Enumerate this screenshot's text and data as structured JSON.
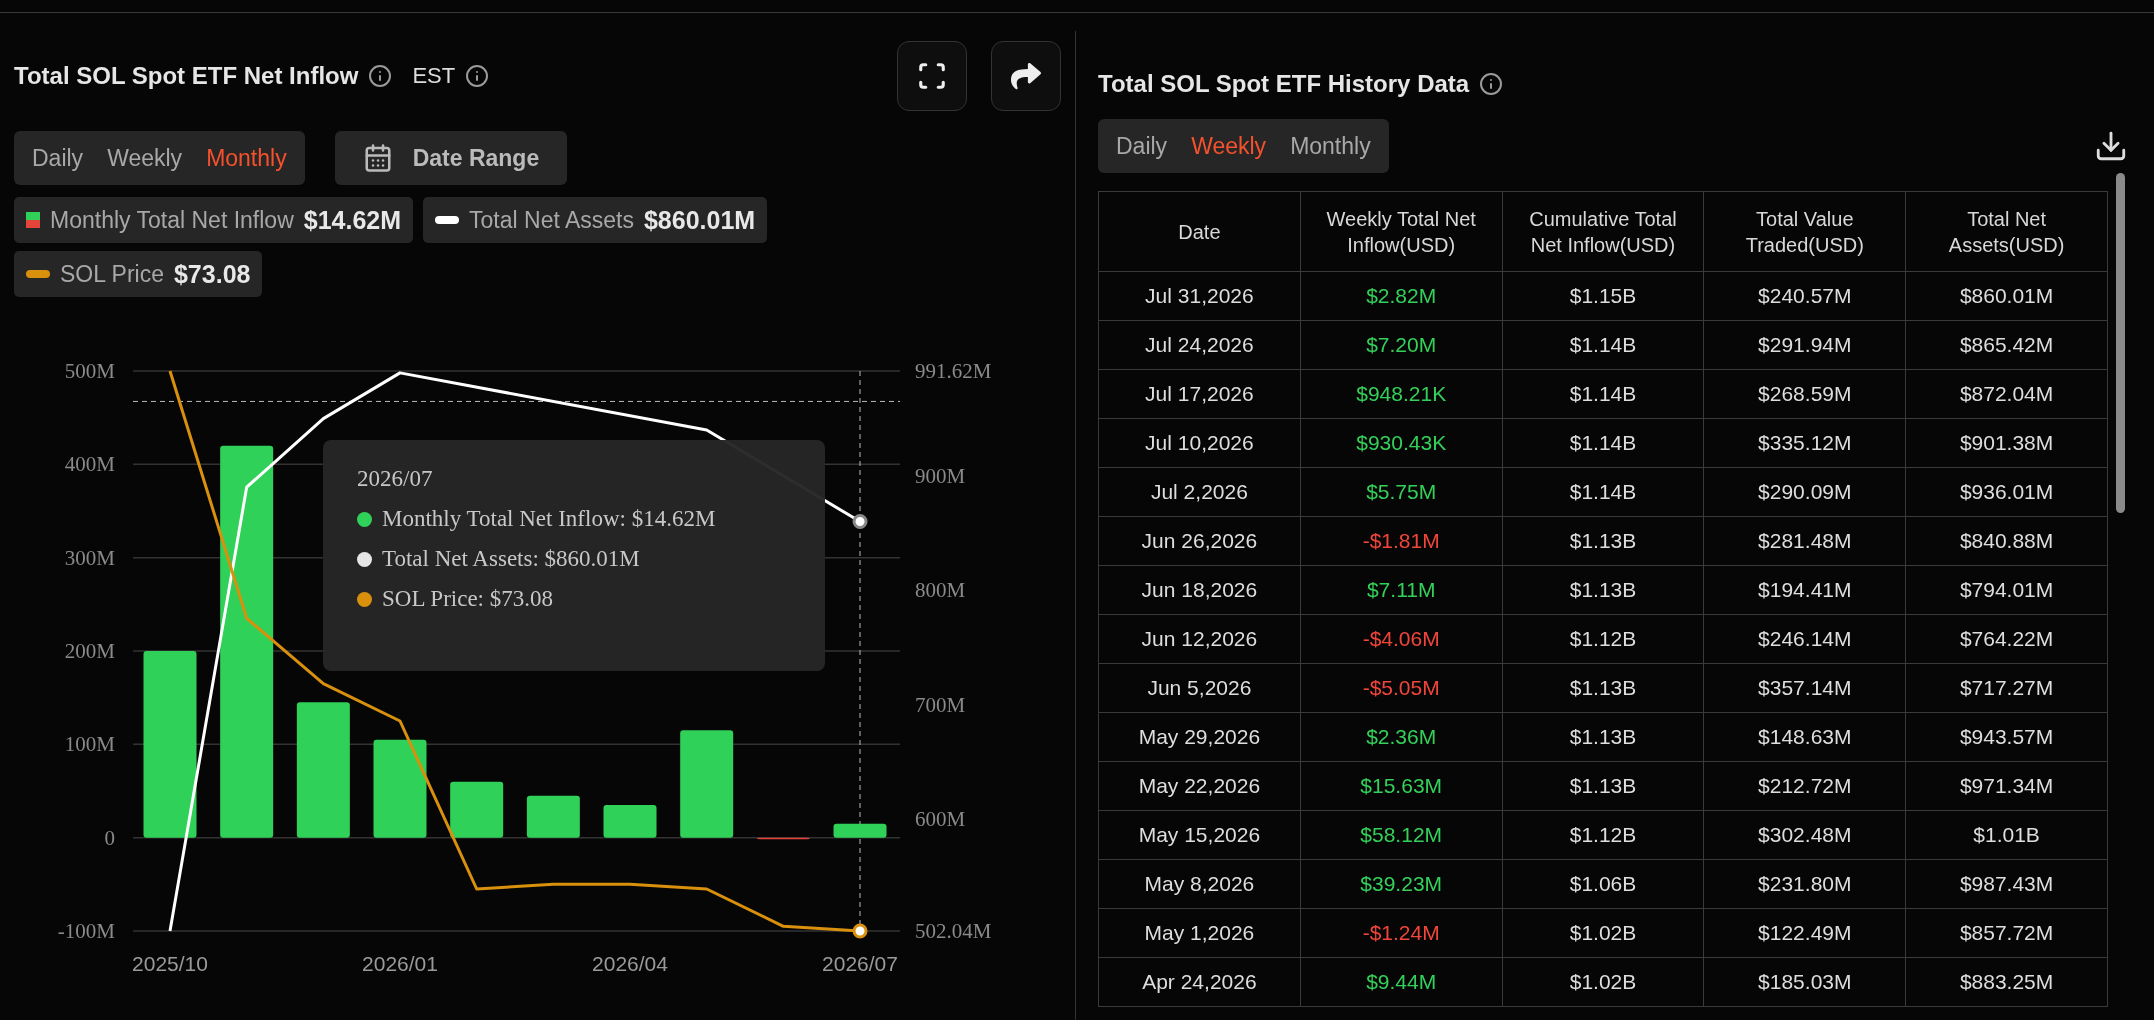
{
  "inflow_panel": {
    "title": "Total SOL Spot ETF Net Inflow",
    "timezone": "EST",
    "tabs": [
      {
        "label": "Daily",
        "selected": false
      },
      {
        "label": "Weekly",
        "selected": false
      },
      {
        "label": "Monthly",
        "selected": true
      }
    ],
    "date_range_button": "Date Range",
    "legend": [
      {
        "kind": "split",
        "value": "$14.62M"
      },
      {
        "kind": "dash",
        "value": "$860.01M",
        "color": "#ffffff"
      },
      {
        "kind": "dash",
        "value": "$73.08",
        "color": "#d9900d"
      }
    ],
    "chart_data": {
      "type": "bar",
      "grid": true,
      "ref_lines": [
        {
          "axis": "y2",
          "value": 965
        }
      ],
      "categories": [
        "2025/10",
        null,
        null,
        "2026/01",
        null,
        null,
        "2026/04",
        null,
        null,
        "2026/07"
      ],
      "ylim": [
        -100,
        500
      ],
      "yticks": [
        {
          "value": -100,
          "label": "-100M"
        },
        {
          "value": 0,
          "label": "0"
        },
        {
          "value": 100,
          "label": "100M"
        },
        {
          "value": 200,
          "label": "200M"
        },
        {
          "value": 300,
          "label": "300M"
        },
        {
          "value": 400,
          "label": "400M"
        },
        {
          "value": 500,
          "label": "500M"
        }
      ],
      "y2lim": [
        502.04,
        991.62
      ],
      "y2ticks": [
        {
          "value": 502.04,
          "label": "502.04M"
        },
        {
          "value": 600,
          "label": "600M"
        },
        {
          "value": 700,
          "label": "700M"
        },
        {
          "value": 800,
          "label": "800M"
        },
        {
          "value": 900,
          "label": "900M"
        },
        {
          "value": 991.62,
          "label": "991.62M"
        }
      ],
      "series": [
        {
          "name": "Monthly Total Net Inflow",
          "color": "#30d158",
          "colors": [
            "#30d158",
            "#30d158",
            "#30d158",
            "#30d158",
            "#30d158",
            "#30d158",
            "#30d158",
            "#30d158",
            "#e5443a",
            "#30d158"
          ],
          "values": [
            200,
            420,
            145,
            105,
            60,
            45,
            35,
            115,
            -1,
            15
          ]
        },
        {
          "name": "Total Net Assets",
          "color": "#ffffff",
          "axis": "y2",
          "type": "line",
          "values": [
            502.04,
            890,
            950,
            990,
            null,
            null,
            null,
            940,
            null,
            860
          ]
        },
        {
          "name": "SOL Price",
          "color": "#d9900d",
          "type": "line",
          "values": [
            500,
            235,
            165,
            125,
            -55,
            -50,
            -50,
            -55,
            -95,
            -100
          ]
        }
      ]
    },
    "tooltip": {
      "title": "2026/07",
      "items": [
        {
          "text": "Monthly Total Net Inflow: $14.62M",
          "color": "#30d158"
        },
        {
          "text": "Total Net Assets: $860.01M",
          "color": "#e6e6e6"
        },
        {
          "text": "SOL Price: $73.08",
          "color": "#d9900d"
        }
      ]
    }
  },
  "history_panel": {
    "title": "Total SOL Spot ETF History Data",
    "tabs": [
      {
        "label": "Daily",
        "selected": false
      },
      {
        "label": "Weekly",
        "selected": true
      },
      {
        "label": "Monthly",
        "selected": false
      }
    ],
    "table": {
      "columns": [
        "Date",
        "Weekly Total Net Inflow(USD)",
        "Cumulative Total Net Inflow(USD)",
        "Total Value Traded(USD)",
        "Total Net Assets(USD)"
      ],
      "rows": [
        {
          "date": "Jul 31,2026",
          "inflow": "$2.82M",
          "kind": "positive",
          "cumulative": "$1.15B",
          "traded": "$240.57M",
          "assets": "$860.01M"
        },
        {
          "date": "Jul 24,2026",
          "inflow": "$7.20M",
          "kind": "positive",
          "cumulative": "$1.14B",
          "traded": "$291.94M",
          "assets": "$865.42M"
        },
        {
          "date": "Jul 17,2026",
          "inflow": "$948.21K",
          "kind": "positive",
          "cumulative": "$1.14B",
          "traded": "$268.59M",
          "assets": "$872.04M"
        },
        {
          "date": "Jul 10,2026",
          "inflow": "$930.43K",
          "kind": "positive",
          "cumulative": "$1.14B",
          "traded": "$335.12M",
          "assets": "$901.38M"
        },
        {
          "date": "Jul 2,2026",
          "inflow": "$5.75M",
          "kind": "positive",
          "cumulative": "$1.14B",
          "traded": "$290.09M",
          "assets": "$936.01M"
        },
        {
          "date": "Jun 26,2026",
          "inflow": "-$1.81M",
          "kind": "negative",
          "cumulative": "$1.13B",
          "traded": "$281.48M",
          "assets": "$840.88M"
        },
        {
          "date": "Jun 18,2026",
          "inflow": "$7.11M",
          "kind": "positive",
          "cumulative": "$1.13B",
          "traded": "$194.41M",
          "assets": "$794.01M"
        },
        {
          "date": "Jun 12,2026",
          "inflow": "-$4.06M",
          "kind": "negative",
          "cumulative": "$1.12B",
          "traded": "$246.14M",
          "assets": "$764.22M"
        },
        {
          "date": "Jun 5,2026",
          "inflow": "-$5.05M",
          "kind": "negative",
          "cumulative": "$1.13B",
          "traded": "$357.14M",
          "assets": "$717.27M"
        },
        {
          "date": "May 29,2026",
          "inflow": "$2.36M",
          "kind": "positive",
          "cumulative": "$1.13B",
          "traded": "$148.63M",
          "assets": "$943.57M"
        },
        {
          "date": "May 22,2026",
          "inflow": "$15.63M",
          "kind": "positive",
          "cumulative": "$1.13B",
          "traded": "$212.72M",
          "assets": "$971.34M"
        },
        {
          "date": "May 15,2026",
          "inflow": "$58.12M",
          "kind": "positive",
          "cumulative": "$1.12B",
          "traded": "$302.48M",
          "assets": "$1.01B"
        },
        {
          "date": "May 8,2026",
          "inflow": "$39.23M",
          "kind": "positive",
          "cumulative": "$1.06B",
          "traded": "$231.80M",
          "assets": "$987.43M"
        },
        {
          "date": "May 1,2026",
          "inflow": "-$1.24M",
          "kind": "negative",
          "cumulative": "$1.02B",
          "traded": "$122.49M",
          "assets": "$857.72M"
        },
        {
          "date": "Apr 24,2026",
          "inflow": "$9.44M",
          "kind": "positive",
          "cumulative": "$1.02B",
          "traded": "$185.03M",
          "assets": "$883.25M"
        }
      ]
    }
  }
}
